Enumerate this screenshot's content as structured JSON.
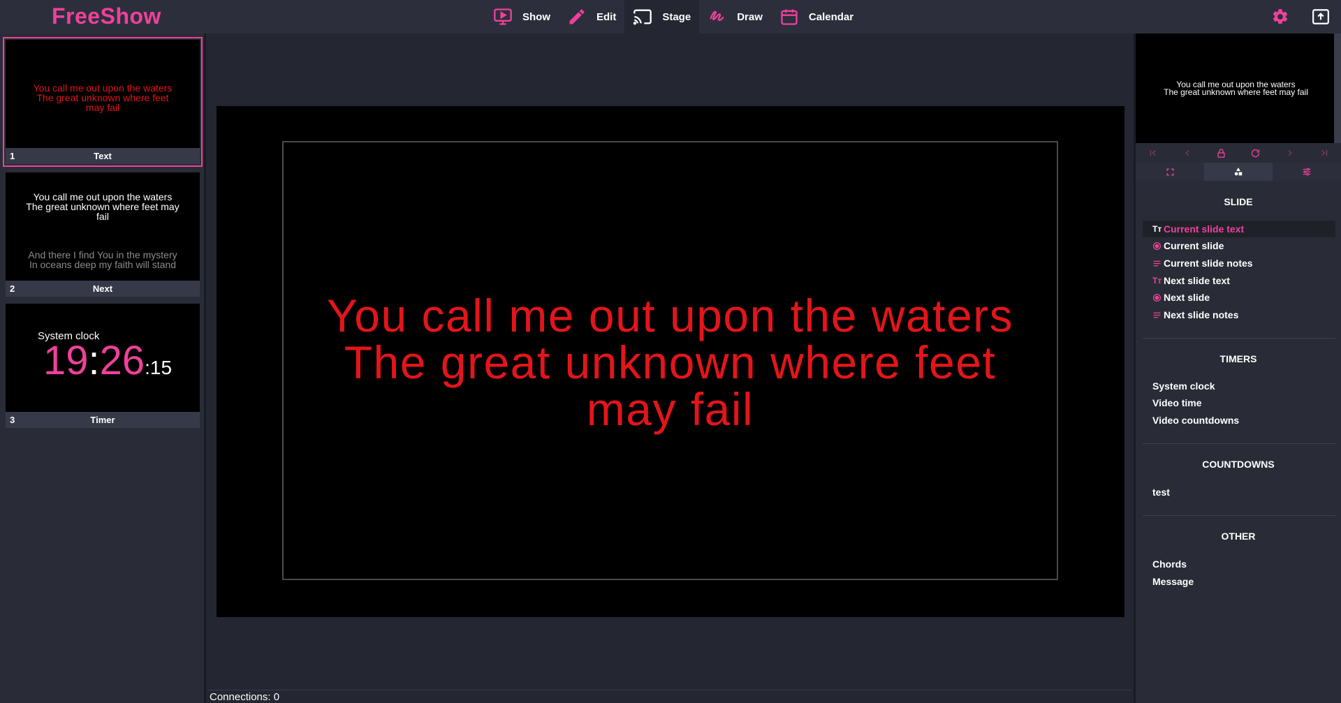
{
  "app": {
    "title": "FreeShow"
  },
  "nav": [
    {
      "label": "Show",
      "icon": "monitor-play-icon"
    },
    {
      "label": "Edit",
      "icon": "pencil-icon"
    },
    {
      "label": "Stage",
      "icon": "cast-icon"
    },
    {
      "label": "Draw",
      "icon": "draw-icon"
    },
    {
      "label": "Calendar",
      "icon": "calendar-icon"
    }
  ],
  "active_nav": "Stage",
  "slides": [
    {
      "number": "1",
      "name": "Text",
      "lines": [
        "You call me out upon the waters",
        "The great unknown where feet",
        "may fail"
      ]
    },
    {
      "number": "2",
      "name": "Next",
      "lines": [
        "You call me out upon the waters",
        "The great unknown where feet may",
        "fail"
      ],
      "next_lines": [
        "And there I find You in the mystery",
        "In oceans deep my faith will stand"
      ]
    },
    {
      "number": "3",
      "name": "Timer",
      "clock_label": "System clock",
      "clock_hours": "19",
      "clock_minutes": "26",
      "clock_seconds": ":15"
    }
  ],
  "stage": {
    "lines": [
      "You call me out upon the waters",
      "The great unknown where feet",
      "may fail"
    ]
  },
  "preview": {
    "lines": [
      "You call me out upon the waters",
      "The great unknown where feet may fail"
    ]
  },
  "status": {
    "connections": "Connections: 0"
  },
  "sections": {
    "slide": {
      "title": "SLIDE",
      "items": [
        "Current slide text",
        "Current slide",
        "Current slide notes",
        "Next slide text",
        "Next slide",
        "Next slide notes"
      ]
    },
    "timers": {
      "title": "TIMERS",
      "items": [
        "System clock",
        "Video time",
        "Video countdowns"
      ]
    },
    "countdowns": {
      "title": "COUNTDOWNS",
      "items": [
        "test"
      ]
    },
    "other": {
      "title": "OTHER",
      "items": [
        "Chords",
        "Message"
      ]
    }
  },
  "colors": {
    "accent": "#f0409c",
    "stage_text": "#e3151a",
    "background": "#242631",
    "panel": "#292c36"
  }
}
